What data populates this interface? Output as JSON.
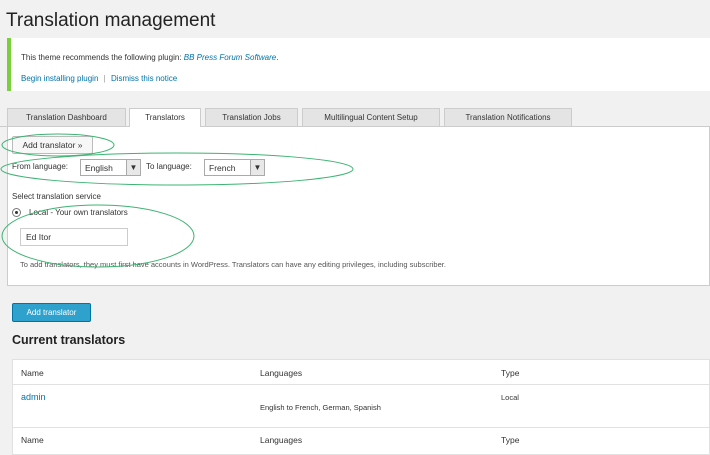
{
  "page": {
    "title": "Translation management"
  },
  "notice": {
    "message_prefix": "This theme recommends the following plugin:",
    "plugin_name": "BB Press Forum Software",
    "message_suffix": ".",
    "begin_install": "Begin installing plugin",
    "separator": "|",
    "dismiss": "Dismiss this notice"
  },
  "tabs": [
    {
      "label": "Translation Dashboard"
    },
    {
      "label": "Translators"
    },
    {
      "label": "Translation Jobs"
    },
    {
      "label": "Multilingual Content Setup"
    },
    {
      "label": "Translation Notifications"
    }
  ],
  "active_tab": "Translators",
  "panel": {
    "add_translator_toggle": "Add translator »",
    "from_language_label": "From language:",
    "from_language_value": "English",
    "to_language_label": "To language:",
    "to_language_value": "French",
    "service_heading": "Select translation service",
    "service_option": "Local - Your own translators",
    "translator_name_value": "Ed Itor",
    "help_text": "To add translators, they must first have accounts in WordPress. Translators can have any editing privileges, including subscriber."
  },
  "add_translator_button": "Add translator",
  "current": {
    "title": "Current translators",
    "columns": [
      "Name",
      "Languages",
      "Type"
    ],
    "rows": [
      {
        "name": "admin",
        "languages": "English to French, German, Spanish",
        "type": "Local"
      }
    ],
    "footer_columns": [
      "Name",
      "Languages",
      "Type"
    ]
  },
  "colors": {
    "notice_border": "#7ad03a",
    "link": "#0073aa",
    "primary_button": "#2ea2cc",
    "annotation": "#3cb371"
  }
}
